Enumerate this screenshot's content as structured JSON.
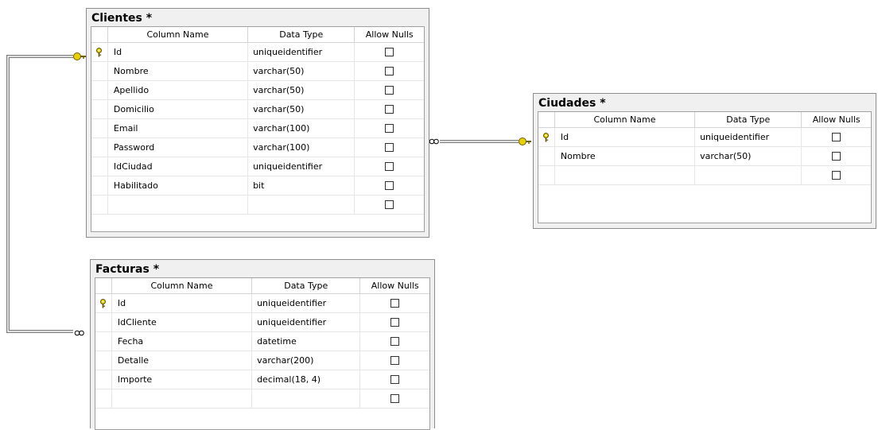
{
  "columns": {
    "name": "Column Name",
    "type": "Data Type",
    "nulls": "Allow Nulls"
  },
  "icons": {
    "primary_key": "key-icon",
    "relationship_one": "key-endpoint-icon",
    "relationship_many": "infinity-endpoint-icon"
  },
  "colors": {
    "key": "#e8d000",
    "line": "#7d7d7d"
  },
  "tables": [
    {
      "title": "Clientes *",
      "rows": [
        {
          "key": true,
          "name": "Id",
          "type": "uniqueidentifier"
        },
        {
          "key": false,
          "name": "Nombre",
          "type": "varchar(50)"
        },
        {
          "key": false,
          "name": "Apellido",
          "type": "varchar(50)"
        },
        {
          "key": false,
          "name": "Domicilio",
          "type": "varchar(50)"
        },
        {
          "key": false,
          "name": "Email",
          "type": "varchar(100)"
        },
        {
          "key": false,
          "name": "Password",
          "type": "varchar(100)"
        },
        {
          "key": false,
          "name": "IdCiudad",
          "type": "uniqueidentifier"
        },
        {
          "key": false,
          "name": "Habilitado",
          "type": "bit"
        },
        {
          "key": false,
          "name": "",
          "type": ""
        }
      ]
    },
    {
      "title": "Ciudades *",
      "rows": [
        {
          "key": true,
          "name": "Id",
          "type": "uniqueidentifier"
        },
        {
          "key": false,
          "name": "Nombre",
          "type": "varchar(50)"
        },
        {
          "key": false,
          "name": "",
          "type": ""
        }
      ]
    },
    {
      "title": "Facturas *",
      "rows": [
        {
          "key": true,
          "name": "Id",
          "type": "uniqueidentifier"
        },
        {
          "key": false,
          "name": "IdCliente",
          "type": "uniqueidentifier"
        },
        {
          "key": false,
          "name": "Fecha",
          "type": "datetime"
        },
        {
          "key": false,
          "name": "Detalle",
          "type": "varchar(200)"
        },
        {
          "key": false,
          "name": "Importe",
          "type": "decimal(18, 4)"
        },
        {
          "key": false,
          "name": "",
          "type": ""
        }
      ]
    }
  ]
}
